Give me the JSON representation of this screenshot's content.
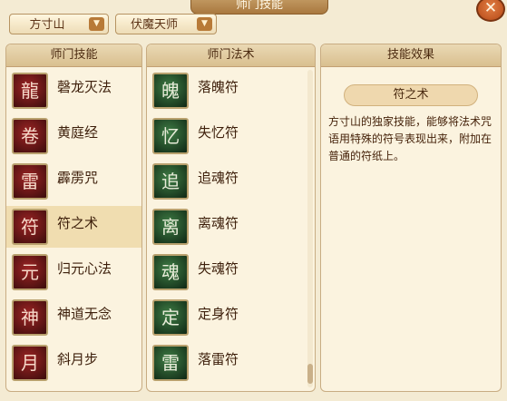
{
  "window": {
    "title": "师门技能",
    "close_symbol": "✕"
  },
  "dropdowns": [
    {
      "value": "方寸山"
    },
    {
      "value": "伏魔天师"
    }
  ],
  "columns": {
    "left_header": "师门技能",
    "middle_header": "师门法术",
    "right_header": "技能效果"
  },
  "skills": [
    {
      "name": "磬龙灭法",
      "icon": "dragon-spiral-icon",
      "glyph": "龍"
    },
    {
      "name": "黄庭经",
      "icon": "scroll-book-icon",
      "glyph": "卷"
    },
    {
      "name": "霹雳咒",
      "icon": "lightning-seal-icon",
      "glyph": "雷"
    },
    {
      "name": "符之术",
      "icon": "talisman-seal-icon",
      "glyph": "符",
      "selected": true
    },
    {
      "name": "归元心法",
      "icon": "spiritual-core-icon",
      "glyph": "元"
    },
    {
      "name": "神道无念",
      "icon": "divine-cross-icon",
      "glyph": "神"
    },
    {
      "name": "斜月步",
      "icon": "moon-step-icon",
      "glyph": "月"
    }
  ],
  "spells": [
    {
      "name": "落魄符",
      "icon": "ghost-seal-icon",
      "glyph": "魄"
    },
    {
      "name": "失忆符",
      "icon": "forget-seal-icon",
      "glyph": "忆"
    },
    {
      "name": "追魂符",
      "icon": "pursuit-seal-icon",
      "glyph": "追"
    },
    {
      "name": "离魂符",
      "icon": "split-soul-icon",
      "glyph": "离"
    },
    {
      "name": "失魂符",
      "icon": "lost-soul-icon",
      "glyph": "魂"
    },
    {
      "name": "定身符",
      "icon": "freeze-seal-icon",
      "glyph": "定"
    },
    {
      "name": "落雷符",
      "icon": "thunder-seal-icon",
      "glyph": "雷"
    }
  ],
  "effect": {
    "title": "符之术",
    "description": "方寸山的独家技能，能够将法术咒语用特殊的符号表现出来，附加在普通的符纸上。"
  }
}
